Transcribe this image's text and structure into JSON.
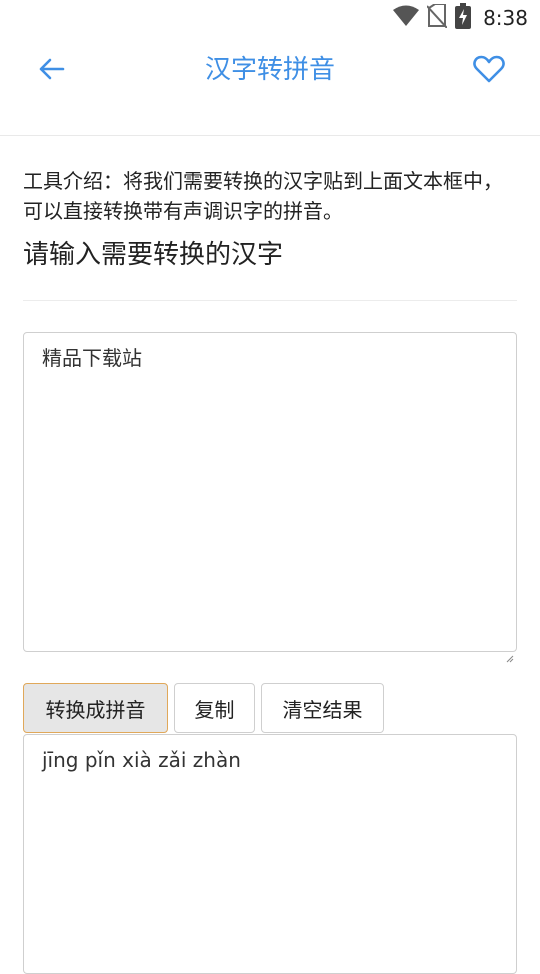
{
  "status_bar": {
    "time": "8:38",
    "icons": [
      "wifi-icon",
      "no-sim-icon",
      "battery-charging-icon"
    ]
  },
  "app_bar": {
    "title": "汉字转拼音",
    "back_icon": "back-arrow-icon",
    "favorite_icon": "heart-outline-icon",
    "accent_color": "#3f8fe5"
  },
  "intro_text": "工具介绍：将我们需要转换的汉字贴到上面文本框中，可以直接转换带有声调识字的拼音。",
  "section_heading": "请输入需要转换的汉字",
  "input": {
    "value": "精品下载站"
  },
  "buttons": {
    "convert": "转换成拼音",
    "copy": "复制",
    "clear": "清空结果"
  },
  "output": {
    "value": "jīng pǐn xià zǎi zhàn"
  }
}
